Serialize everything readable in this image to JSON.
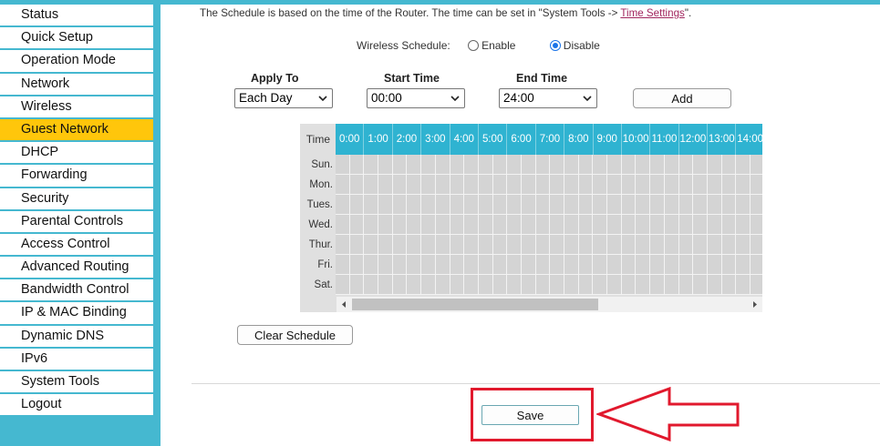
{
  "sidebar": {
    "items": [
      {
        "label": "Status"
      },
      {
        "label": "Quick Setup"
      },
      {
        "label": "Operation Mode"
      },
      {
        "label": "Network"
      },
      {
        "label": "Wireless"
      },
      {
        "label": "Guest Network",
        "active": true
      },
      {
        "label": "DHCP"
      },
      {
        "label": "Forwarding"
      },
      {
        "label": "Security"
      },
      {
        "label": "Parental Controls"
      },
      {
        "label": "Access Control"
      },
      {
        "label": "Advanced Routing"
      },
      {
        "label": "Bandwidth Control"
      },
      {
        "label": "IP & MAC Binding"
      },
      {
        "label": "Dynamic DNS"
      },
      {
        "label": "IPv6"
      },
      {
        "label": "System Tools"
      },
      {
        "label": "Logout"
      }
    ]
  },
  "notice": {
    "text_before": "The Schedule is based on the time of the Router. The time can be set in \"System Tools -> ",
    "link": "Time Settings",
    "text_after": "\"."
  },
  "wireless_schedule": {
    "label": "Wireless Schedule:",
    "enable_label": "Enable",
    "disable_label": "Disable",
    "selected": "Disable"
  },
  "form": {
    "apply_to_label": "Apply To",
    "apply_to_value": "Each Day",
    "start_time_label": "Start Time",
    "start_time_value": "00:00",
    "end_time_label": "End Time",
    "end_time_value": "24:00",
    "add_label": "Add"
  },
  "schedule": {
    "time_label": "Time",
    "hours": [
      "0:00",
      "1:00",
      "2:00",
      "3:00",
      "4:00",
      "5:00",
      "6:00",
      "7:00",
      "8:00",
      "9:00",
      "10:00",
      "11:00",
      "12:00",
      "13:00",
      "14:00"
    ],
    "days": [
      "Sun.",
      "Mon.",
      "Tues.",
      "Wed.",
      "Thur.",
      "Fri.",
      "Sat."
    ]
  },
  "clear_schedule_label": "Clear Schedule",
  "save_label": "Save",
  "colors": {
    "sidebar_bg": "#45b8d0",
    "active_menu": "#ffc60b",
    "header_cell": "#2fb3d1",
    "highlight": "#e1192d",
    "link": "#a1265e"
  }
}
